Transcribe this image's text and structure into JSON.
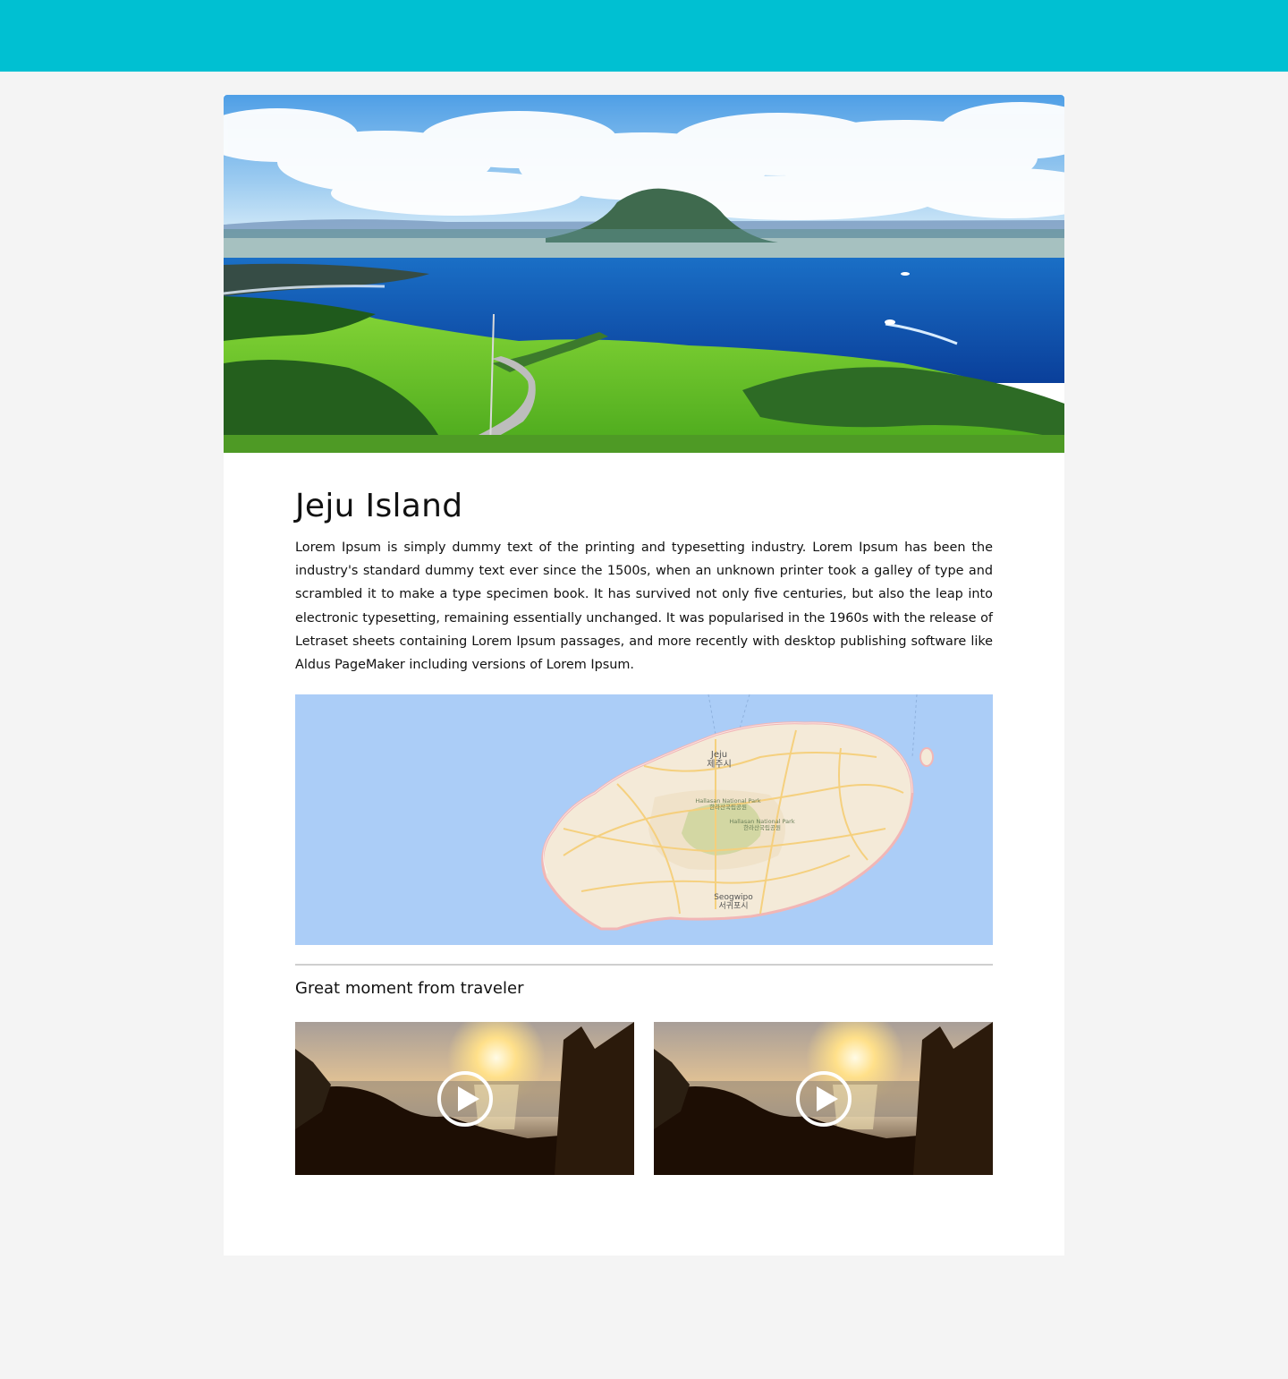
{
  "colors": {
    "header_bar": "#00c0d2",
    "page_background": "#f4f4f4",
    "card_background": "#ffffff",
    "map_water": "#abcdf7",
    "map_land": "#f4ead8",
    "map_park": "#b9d38c",
    "map_roads": "#f6cf7a"
  },
  "hero": {
    "image": "jeju-coastline-photo"
  },
  "article": {
    "title": "Jeju Island",
    "description": "Lorem Ipsum is simply dummy text of the printing and typesetting industry. Lorem Ipsum has been the industry's standard dummy text ever since the 1500s, when an unknown printer took a galley of type and scrambled it to make a type specimen book. It has survived not only five centuries, but also the leap into electronic typesetting, remaining essentially unchanged. It was popularised in the 1960s with the release of Letraset sheets containing Lorem Ipsum passages, and more recently with desktop publishing software like Aldus PageMaker including versions of Lorem Ipsum."
  },
  "map": {
    "labels": {
      "jeju_en": "Jeju",
      "jeju_ko": "제주시",
      "park1_en": "Hallasan National Park",
      "park1_ko": "한라산국립공원",
      "park2_en": "Hallasan National Park",
      "park2_ko": "한라산국립공원",
      "seogwipo_en": "Seogwipo",
      "seogwipo_ko": "서귀포시"
    }
  },
  "moments": {
    "heading": "Great moment from traveler",
    "videos": [
      {
        "thumbnail": "sunset-video-thumbnail",
        "icon": "play-icon"
      },
      {
        "thumbnail": "sunset-video-thumbnail",
        "icon": "play-icon"
      }
    ]
  }
}
